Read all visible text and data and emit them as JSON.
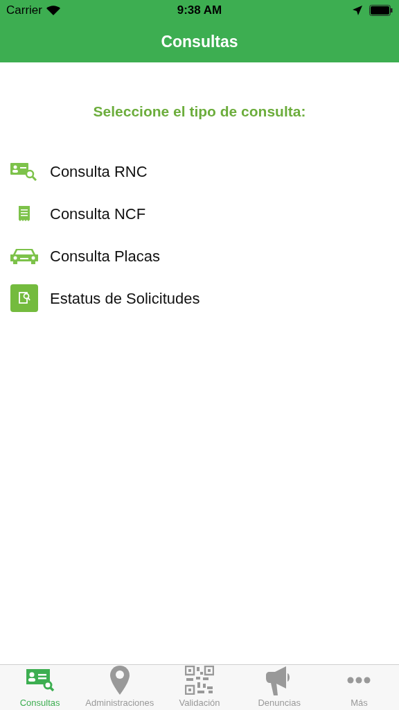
{
  "status_bar": {
    "carrier": "Carrier",
    "time": "9:38 AM"
  },
  "nav_bar": {
    "title": "Consultas"
  },
  "heading": "Seleccione el tipo de consulta:",
  "options": [
    {
      "kind": "id-card",
      "label": "Consulta RNC"
    },
    {
      "kind": "receipt",
      "label": "Consulta NCF"
    },
    {
      "kind": "car",
      "label": "Consulta Placas"
    },
    {
      "kind": "status",
      "label": "Estatus de Solicitudes"
    }
  ],
  "tabs": [
    {
      "kind": "id-card",
      "label": "Consultas",
      "selected": true
    },
    {
      "kind": "pin",
      "label": "Administraciones",
      "selected": false
    },
    {
      "kind": "qr",
      "label": "Validación",
      "selected": false
    },
    {
      "kind": "megaphone",
      "label": "Denuncias",
      "selected": false
    },
    {
      "kind": "more",
      "label": "Más",
      "selected": false
    }
  ]
}
